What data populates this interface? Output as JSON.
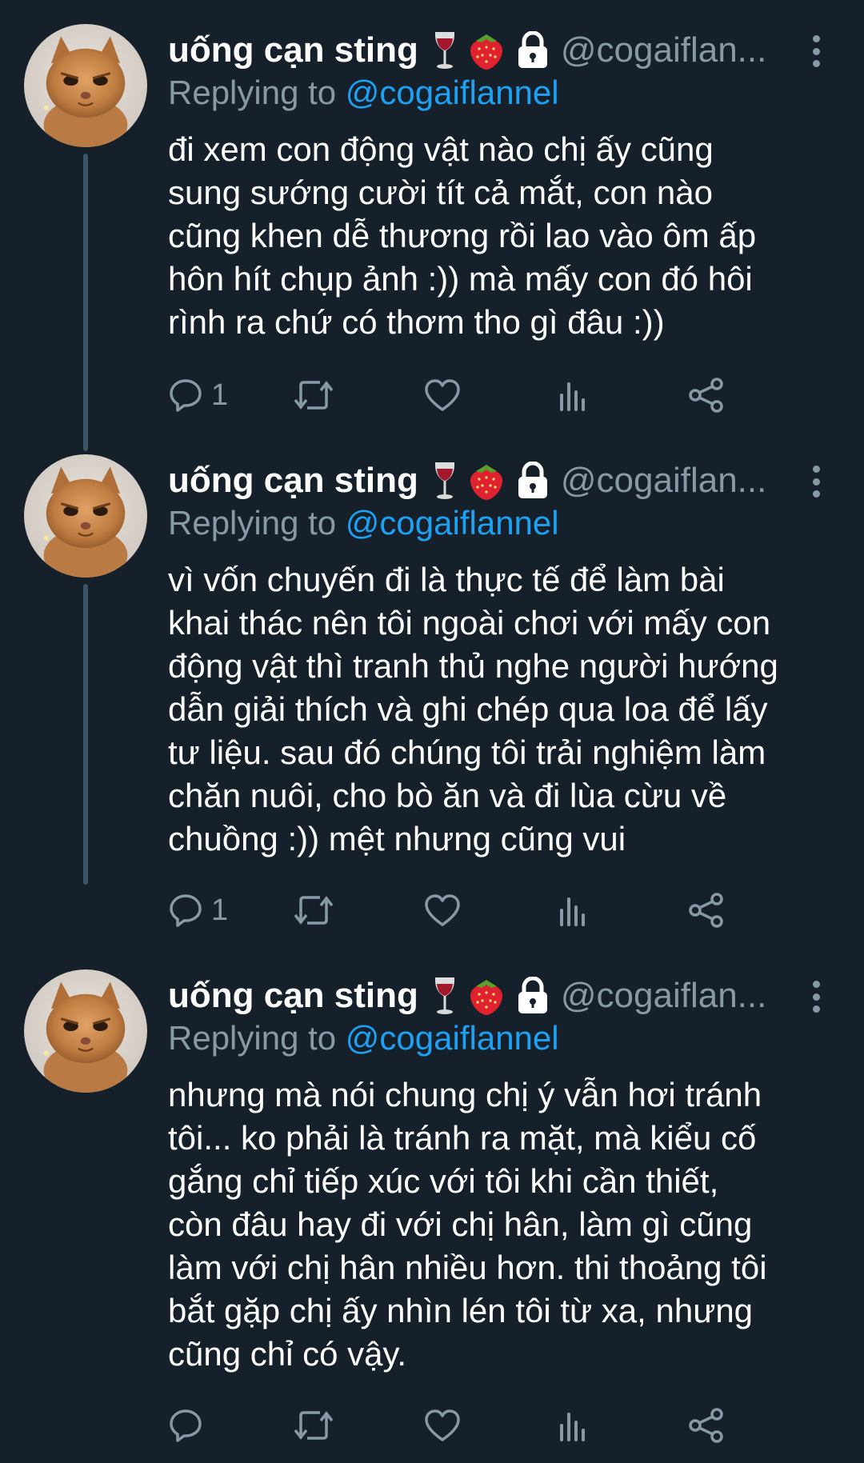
{
  "tweets": [
    {
      "name": "uống cạn sting",
      "handle": "@cogaiflan...",
      "replying_prefix": "Replying to ",
      "replying_handle": "@cogaiflannel",
      "lines": [
        "đi xem con động vật nào chị ấy cũng",
        "sung sướng cười tít cả mắt, con nào",
        "cũng khen dễ thương rồi lao vào ôm ấp",
        "hôn hít chụp ảnh :)) mà mấy con đó hôi",
        "rình ra chứ có thơm tho gì đâu :))"
      ],
      "reply_count": "1"
    },
    {
      "name": "uống cạn sting",
      "handle": "@cogaiflan...",
      "replying_prefix": "Replying to ",
      "replying_handle": "@cogaiflannel",
      "lines": [
        "vì vốn chuyến đi là thực tế để làm bài",
        "khai thác nên tôi ngoài chơi với mấy con",
        "động vật thì tranh thủ nghe người hướng",
        "dẫn giải thích và ghi chép qua loa để lấy",
        "tư liệu. sau đó chúng tôi trải nghiệm làm",
        "chăn nuôi, cho bò ăn và đi lùa cừu về",
        "chuồng :)) mệt nhưng cũng vui"
      ],
      "reply_count": "1"
    },
    {
      "name": "uống cạn sting",
      "handle": "@cogaiflan...",
      "replying_prefix": "Replying to ",
      "replying_handle": "@cogaiflannel",
      "lines": [
        "nhưng mà nói chung chị ý vẫn hơi tránh",
        "tôi... ko phải là tránh ra mặt, mà kiểu cố",
        "gắng chỉ tiếp xúc với tôi khi cần thiết,",
        "còn đâu hay đi với chị hân, làm gì cũng",
        "làm với chị hân nhiều hơn. thi thoảng tôi",
        "bắt gặp chị ấy nhìn lén tôi từ xa, nhưng",
        "cũng chỉ có vậy."
      ],
      "reply_count": ""
    }
  ],
  "colors": {
    "background": "#15202b",
    "secondary_text": "#8899a6",
    "accent": "#1da1f2",
    "thread_line": "#3d5466"
  },
  "icons": {
    "name_emojis": [
      "wine-glass-icon",
      "strawberry-icon",
      "lock-icon"
    ],
    "actions": [
      "reply-icon",
      "retweet-icon",
      "like-icon",
      "analytics-icon",
      "share-icon"
    ]
  }
}
